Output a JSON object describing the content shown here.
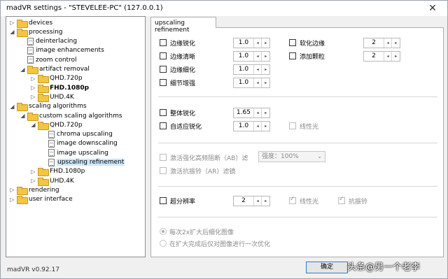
{
  "window": {
    "title": "madVR settings - \"STEVELEE-PC\" (127.0.0.1)",
    "close_glyph": "✕",
    "version": "madVR v0.92.17"
  },
  "tree": [
    {
      "label": "devices",
      "expander": "▷",
      "icon": "folder-icon",
      "bold": false,
      "selected": false
    },
    {
      "label": "processing",
      "expander": "◢",
      "icon": "folder-icon",
      "bold": false,
      "selected": false
    },
    {
      "label": "deinterlacing",
      "expander": "",
      "icon": "page-icon",
      "bold": false,
      "selected": false
    },
    {
      "label": "image enhancements",
      "expander": "",
      "icon": "page-icon",
      "bold": false,
      "selected": false
    },
    {
      "label": "zoom control",
      "expander": "",
      "icon": "page-icon",
      "bold": false,
      "selected": false
    },
    {
      "label": "artifact removal",
      "expander": "◢",
      "icon": "folder-icon",
      "bold": false,
      "selected": false
    },
    {
      "label": "QHD.720p",
      "expander": "▷",
      "icon": "folder-icon",
      "bold": false,
      "selected": false
    },
    {
      "label": "FHD.1080p",
      "expander": "▷",
      "icon": "folder-icon",
      "bold": true,
      "selected": false
    },
    {
      "label": "UHD.4K",
      "expander": "▷",
      "icon": "folder-icon",
      "bold": false,
      "selected": false
    },
    {
      "label": "scaling algorithms",
      "expander": "◢",
      "icon": "folder-icon",
      "bold": false,
      "selected": false
    },
    {
      "label": "custom scaling algorithms",
      "expander": "◢",
      "icon": "folder-icon",
      "bold": false,
      "selected": false
    },
    {
      "label": "QHD.720p",
      "expander": "◢",
      "icon": "folder-icon",
      "bold": false,
      "selected": false
    },
    {
      "label": "chroma upscaling",
      "expander": "",
      "icon": "page-icon",
      "bold": false,
      "selected": false
    },
    {
      "label": "image downscaling",
      "expander": "",
      "icon": "page-icon",
      "bold": false,
      "selected": false
    },
    {
      "label": "image upscaling",
      "expander": "",
      "icon": "page-icon",
      "bold": false,
      "selected": false
    },
    {
      "label": "upscaling refinement",
      "expander": "",
      "icon": "page-icon",
      "bold": false,
      "selected": true
    },
    {
      "label": "FHD.1080p",
      "expander": "▷",
      "icon": "folder-icon",
      "bold": false,
      "selected": false
    },
    {
      "label": "UHD.4K",
      "expander": "▷",
      "icon": "folder-icon",
      "bold": false,
      "selected": false
    },
    {
      "label": "rendering",
      "expander": "▷",
      "icon": "folder-icon",
      "bold": false,
      "selected": false
    },
    {
      "label": "user interface",
      "expander": "▷",
      "icon": "folder-icon",
      "bold": false,
      "selected": false
    }
  ],
  "tab": {
    "label": "upscaling refinement"
  },
  "options": {
    "edge_sharpen": {
      "label": "边缘锐化",
      "value": "1.0",
      "checked": false
    },
    "edge_clear": {
      "label": "边缘清晰",
      "value": "1.0",
      "checked": false
    },
    "edge_thin": {
      "label": "边缘细化",
      "value": "1.0",
      "checked": false
    },
    "detail_enhance": {
      "label": "细节增强",
      "value": "1.0",
      "checked": false
    },
    "soften_edges": {
      "label": "软化边缘",
      "value": "2",
      "checked": false
    },
    "add_grain": {
      "label": "添加颗粒",
      "value": "2",
      "checked": false
    },
    "overall_sharpen": {
      "label": "整体锐化",
      "value": "1.65",
      "checked": false
    },
    "adaptive_sharpen": {
      "label": "自适应锐化",
      "value": "1.0",
      "checked": false
    },
    "adaptive_linear": {
      "label": "线性光",
      "checked": false
    },
    "ab_filter": {
      "label": "激活强化高频阻断（AB）滤",
      "combo_value": "强度：100%",
      "checked": false
    },
    "ar_filter": {
      "label": "激活抗振铃（AR）滤镜",
      "checked": false
    },
    "super_res": {
      "label": "超分辨率",
      "value": "2",
      "checked": false
    },
    "super_res_linear": {
      "label": "线性光",
      "checked": true
    },
    "super_res_antiring": {
      "label": "抗振铃",
      "checked": true
    }
  },
  "radios": [
    {
      "label": "每次2x扩大后细化图像",
      "selected": true
    },
    {
      "label": "在扩大完成后仅对图像进行一次优化",
      "selected": false
    }
  ],
  "spin_glyphs": {
    "left": "◂",
    "right": "▸"
  },
  "buttons": {
    "ok": "确定"
  },
  "watermark": "头条@另一个老李"
}
